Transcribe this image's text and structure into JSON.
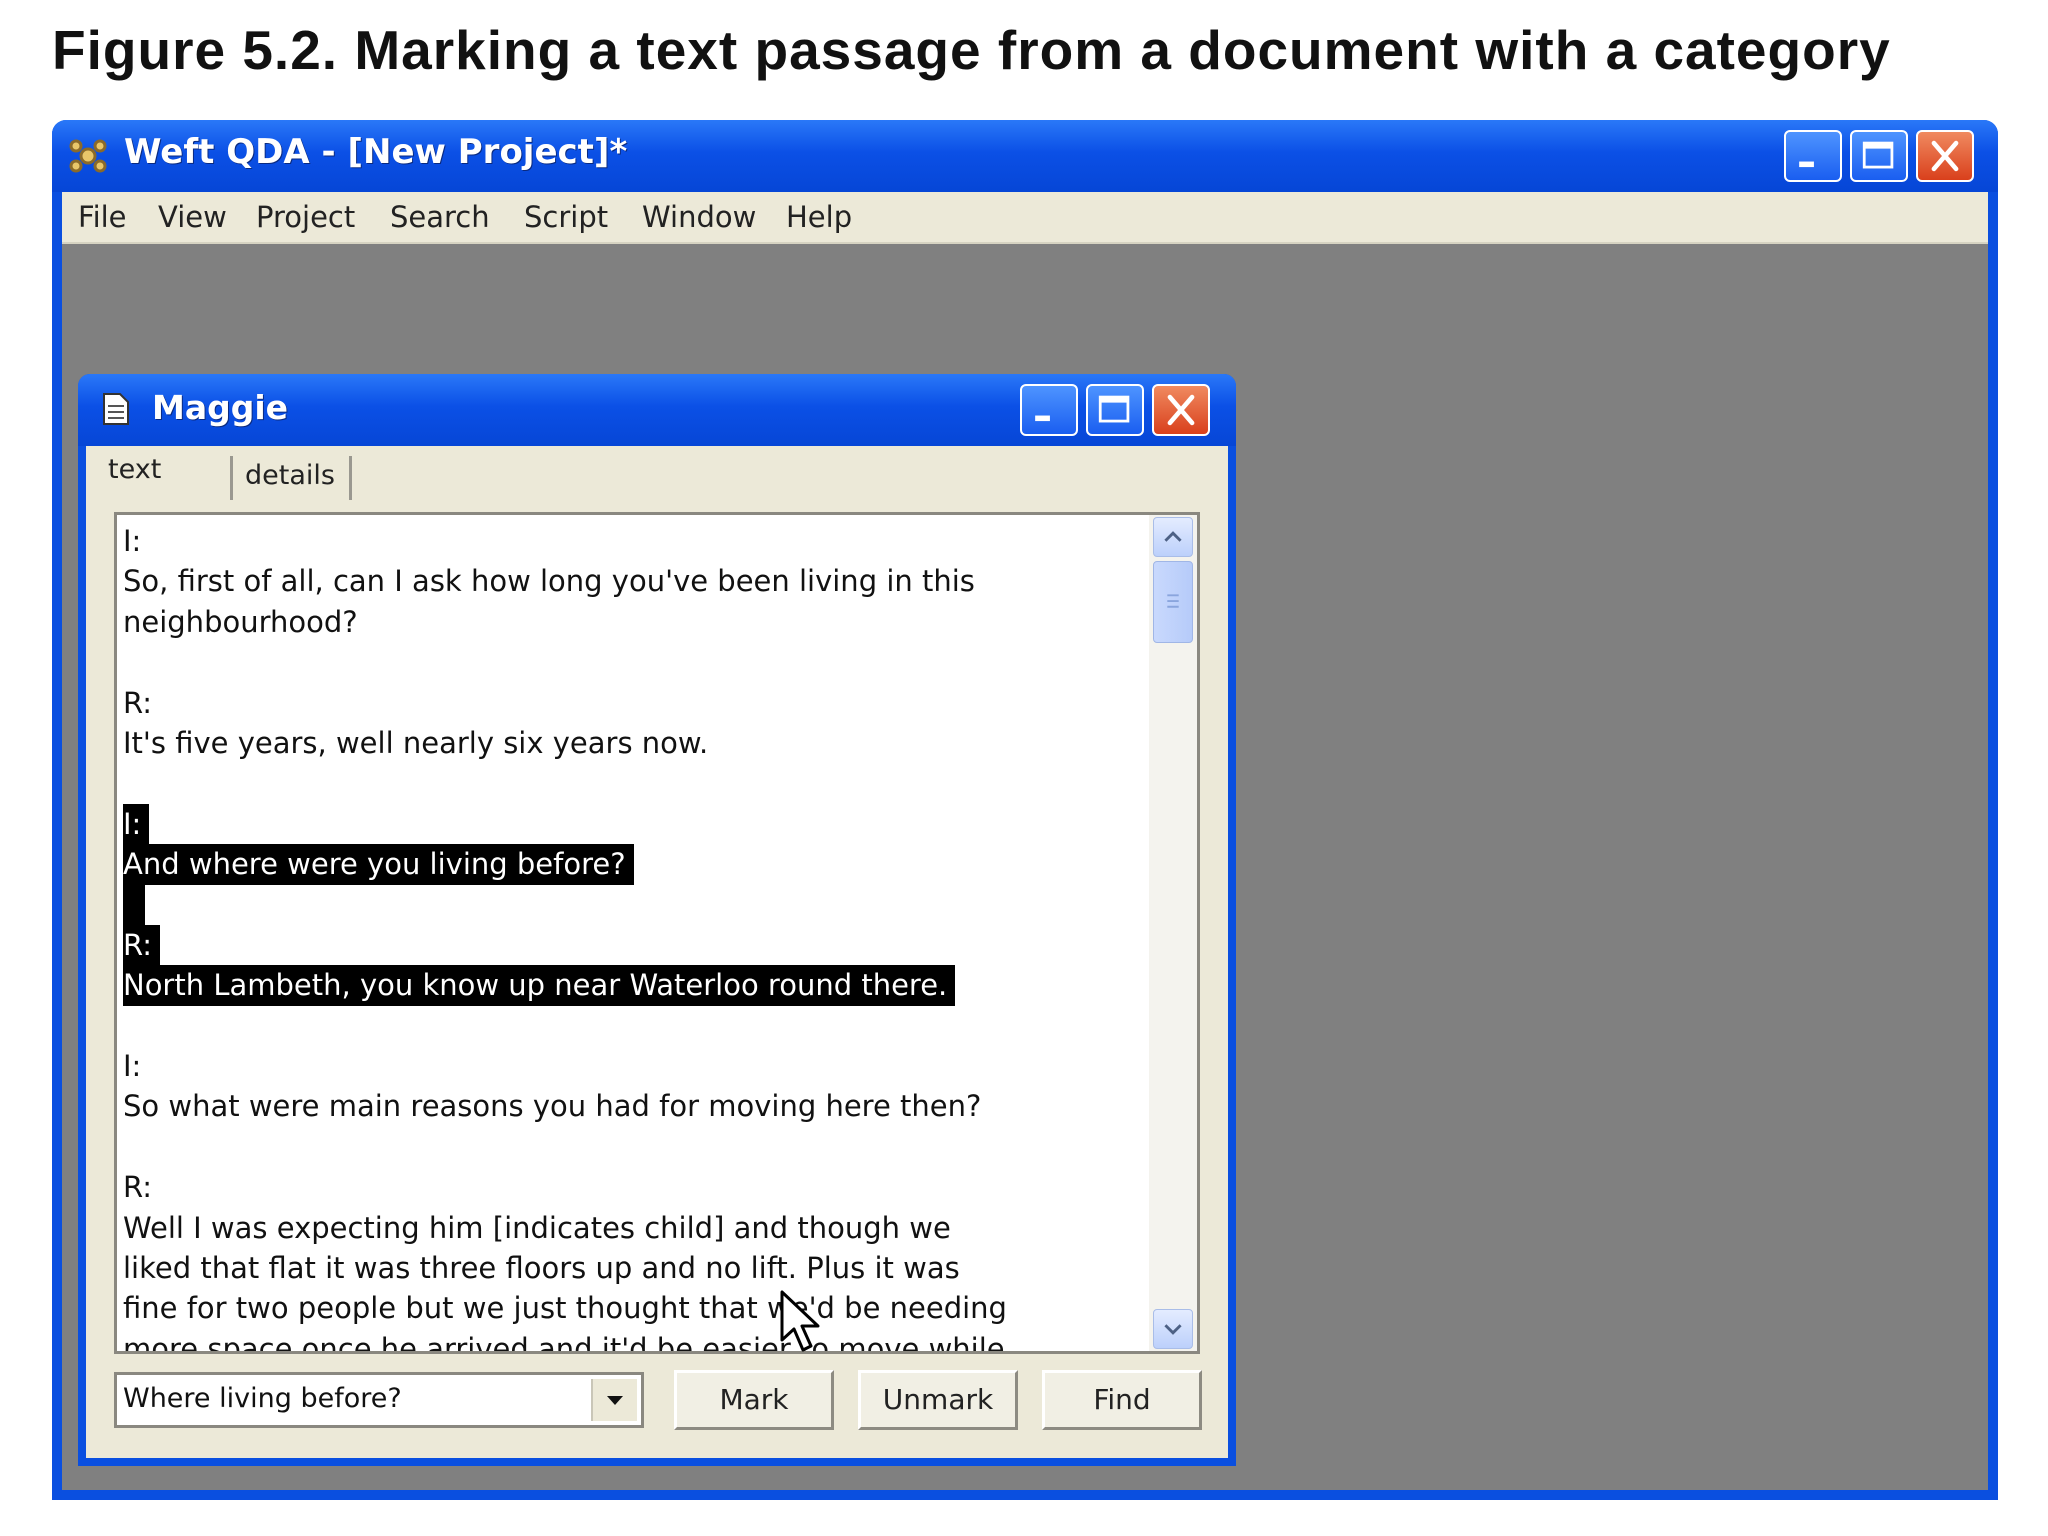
{
  "caption": "Figure 5.2. Marking a text passage from a document with a category",
  "app": {
    "title": "Weft QDA - [New Project]*",
    "icon": "weft-qda-logo-icon",
    "menu": [
      "File",
      "View",
      "Project",
      "Search",
      "Script",
      "Window",
      "Help"
    ]
  },
  "document_window": {
    "title": "Maggie",
    "icon": "document-icon",
    "tabs": [
      "text",
      "details"
    ],
    "active_tab": "text",
    "lines": [
      {
        "text": "I:",
        "selected": false
      },
      {
        "text": "So, first of all, can I ask how long you've been living in this",
        "selected": false
      },
      {
        "text": "neighbourhood?",
        "selected": false
      },
      {
        "text": "",
        "selected": false
      },
      {
        "text": "R:",
        "selected": false
      },
      {
        "text": "It's five years, well nearly six years now.",
        "selected": false
      },
      {
        "text": "",
        "selected": false
      },
      {
        "text": "I:",
        "selected": true
      },
      {
        "text": "And where were you living before?",
        "selected": true
      },
      {
        "text": "",
        "selected": true
      },
      {
        "text": "R:",
        "selected": true
      },
      {
        "text": "North Lambeth, you know up near Waterloo round there.",
        "selected": true
      },
      {
        "text": "",
        "selected": false
      },
      {
        "text": "I:",
        "selected": false
      },
      {
        "text": "So what were main reasons you had for moving here then?",
        "selected": false
      },
      {
        "text": "",
        "selected": false
      },
      {
        "text": "R:",
        "selected": false
      },
      {
        "text": "Well I was expecting him [indicates child] and though we",
        "selected": false
      },
      {
        "text": "liked that flat it was three floors up and no lift. Plus it was",
        "selected": false
      },
      {
        "text": "fine for two people but we just thought that we'd be needing",
        "selected": false
      },
      {
        "text": "more space once he arrived and it'd be easier to move while",
        "selected": false
      }
    ],
    "category_select": {
      "value": "Where living before?"
    },
    "buttons": {
      "mark": "Mark",
      "unmark": "Unmark",
      "find": "Find"
    }
  },
  "colors": {
    "title_bar": "#0a4fe0",
    "window_face": "#ece9d8",
    "mdi_background": "#808080",
    "selection": "#000000"
  }
}
